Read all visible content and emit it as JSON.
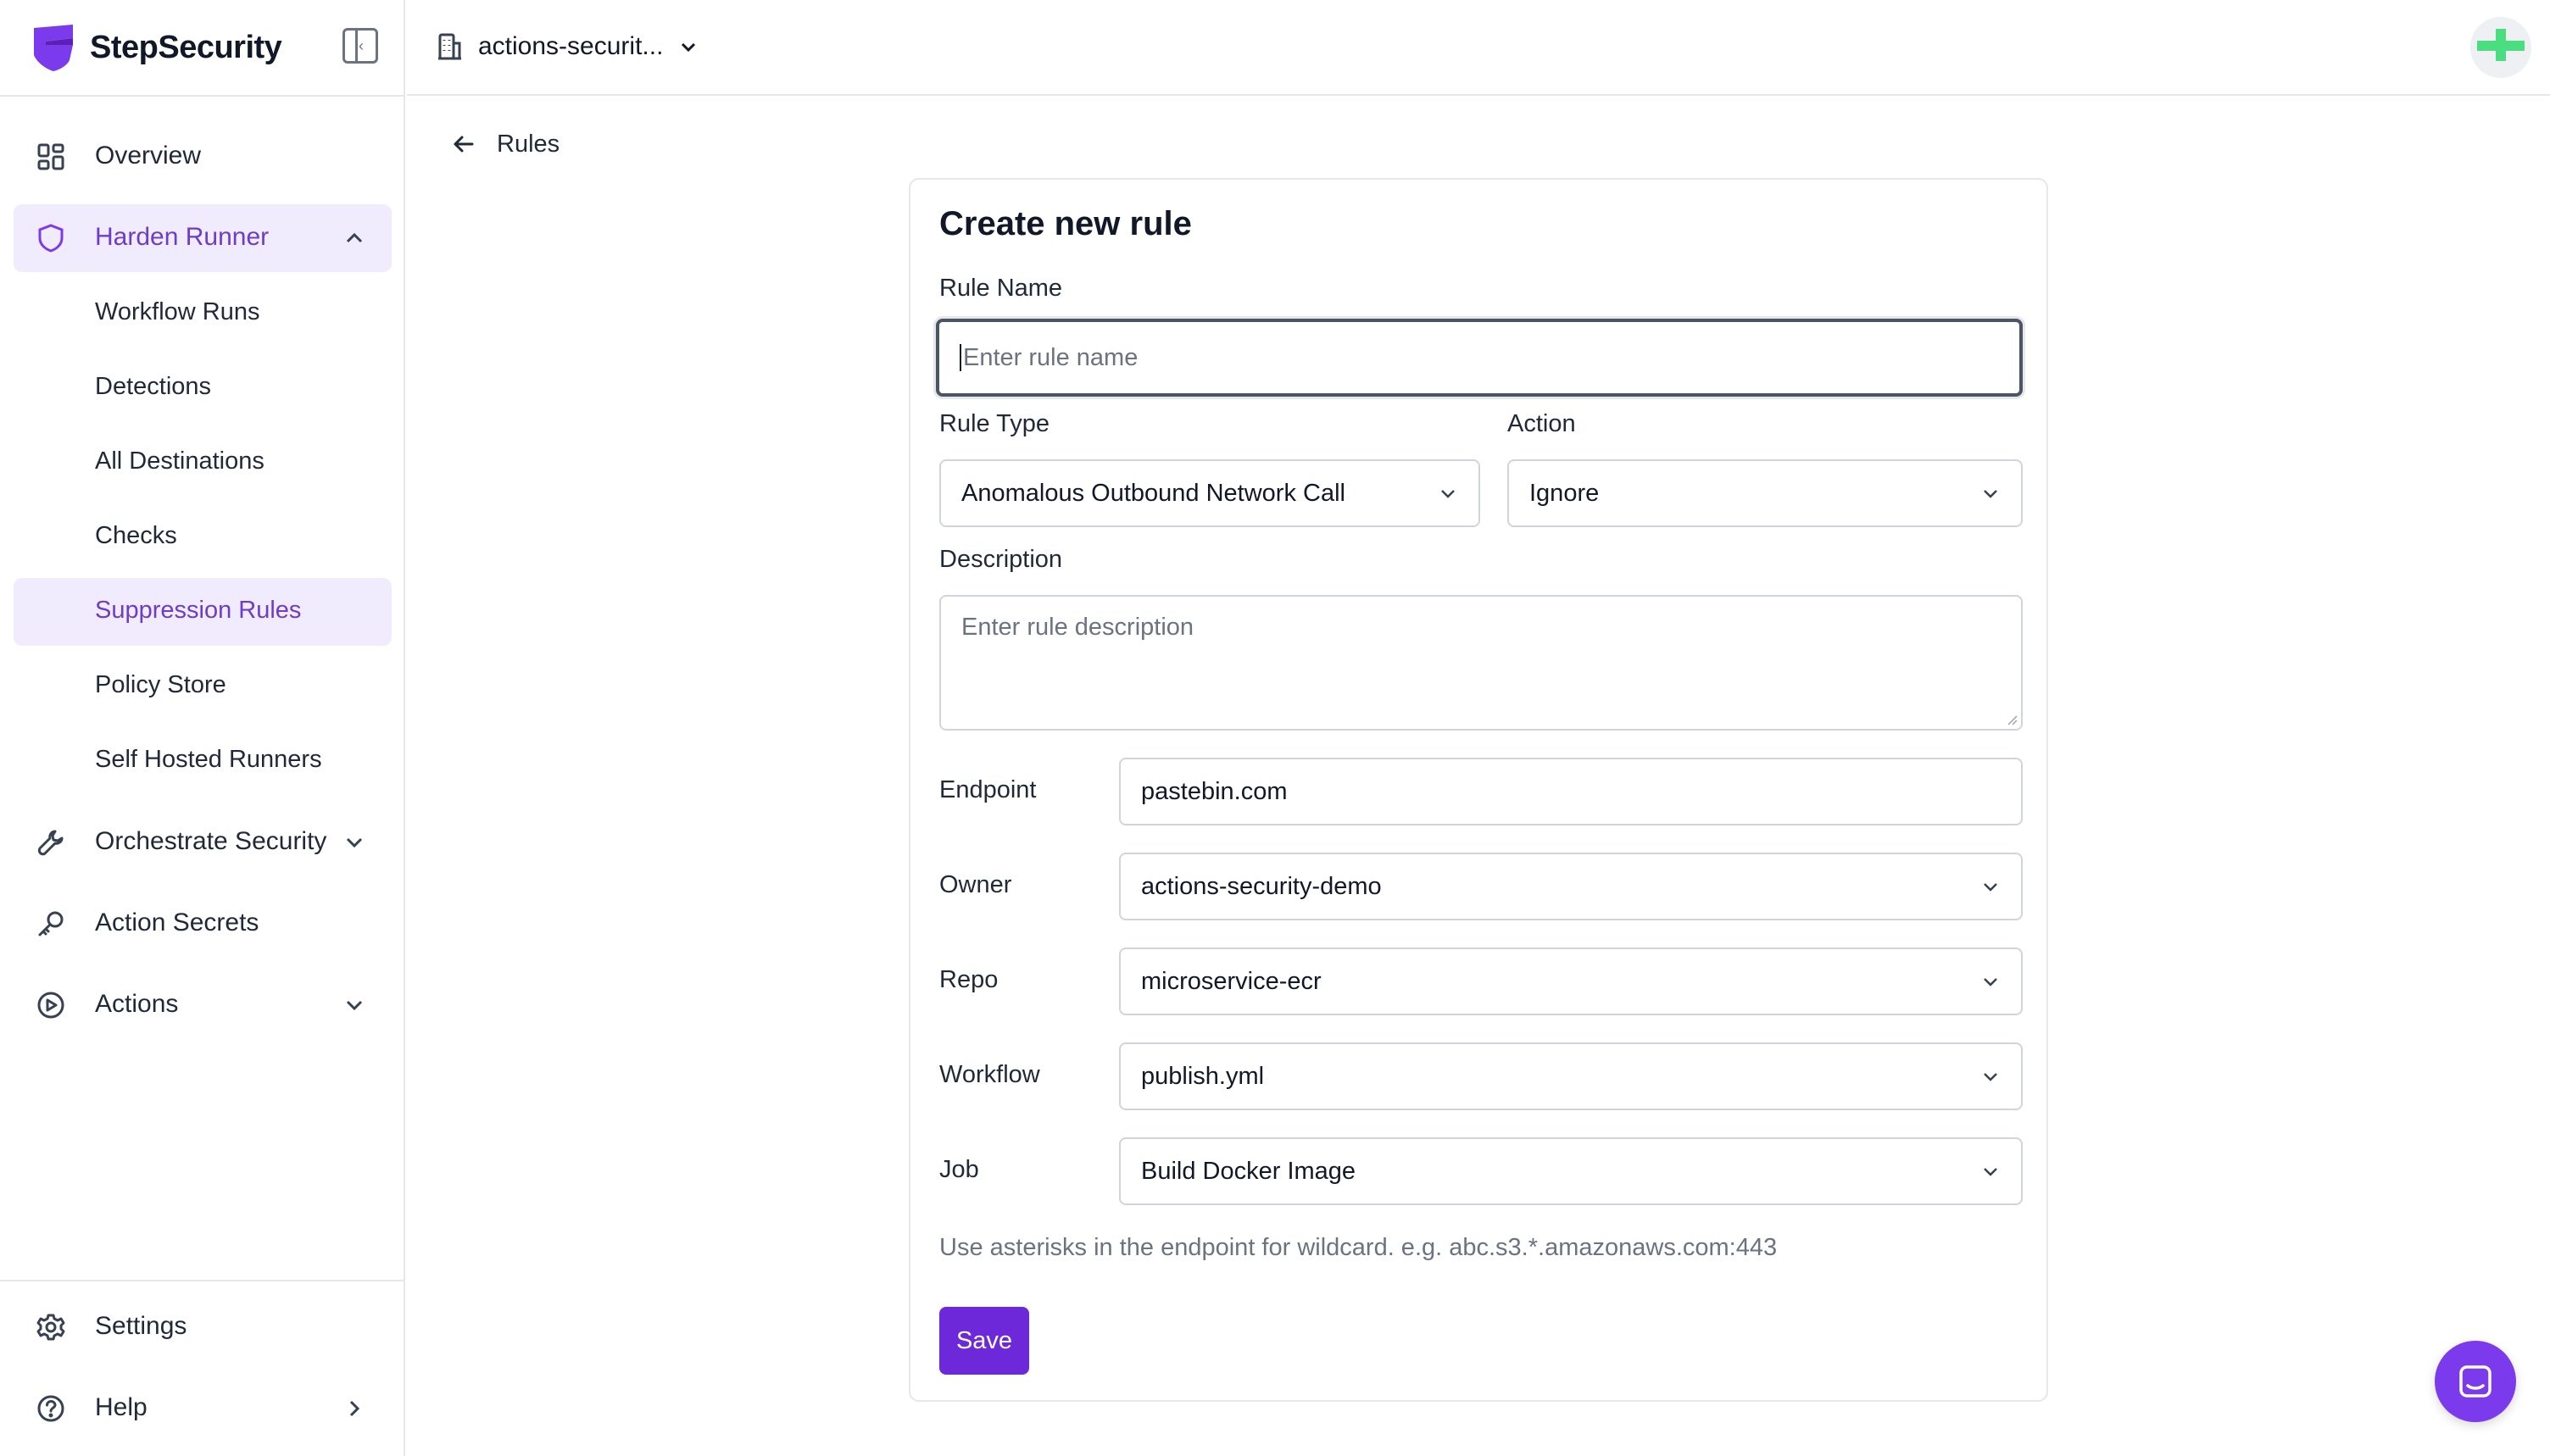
{
  "brand": {
    "name": "StepSecurity",
    "accent": "#6d28d9"
  },
  "header": {
    "org_name": "actions-securit..."
  },
  "sidebar": {
    "items": [
      {
        "label": "Overview",
        "icon": "grid-icon"
      },
      {
        "label": "Harden Runner",
        "icon": "shield-icon",
        "expanded": true,
        "children": [
          {
            "label": "Workflow Runs"
          },
          {
            "label": "Detections"
          },
          {
            "label": "All Destinations"
          },
          {
            "label": "Checks"
          },
          {
            "label": "Suppression Rules",
            "active": true
          },
          {
            "label": "Policy Store"
          },
          {
            "label": "Self Hosted Runners"
          }
        ]
      },
      {
        "label": "Orchestrate Security",
        "icon": "wrench-icon"
      },
      {
        "label": "Action Secrets",
        "icon": "key-icon"
      },
      {
        "label": "Actions",
        "icon": "play-circle-icon"
      }
    ],
    "footer": [
      {
        "label": "Settings",
        "icon": "gear-icon"
      },
      {
        "label": "Help",
        "icon": "help-circle-icon"
      }
    ]
  },
  "main": {
    "back_label": "Rules",
    "form": {
      "title": "Create new rule",
      "rule_name_label": "Rule Name",
      "rule_name_placeholder": "Enter rule name",
      "rule_name_value": "",
      "rule_type_label": "Rule Type",
      "rule_type_value": "Anomalous Outbound Network Call",
      "action_label": "Action",
      "action_value": "Ignore",
      "description_label": "Description",
      "description_placeholder": "Enter rule description",
      "endpoint_label": "Endpoint",
      "endpoint_value": "pastebin.com",
      "owner_label": "Owner",
      "owner_value": "actions-security-demo",
      "repo_label": "Repo",
      "repo_value": "microservice-ecr",
      "workflow_label": "Workflow",
      "workflow_value": "publish.yml",
      "job_label": "Job",
      "job_value": "Build Docker Image",
      "hint": "Use asterisks in the endpoint for wildcard. e.g. abc.s3.*.amazonaws.com:443",
      "save_label": "Save"
    }
  }
}
